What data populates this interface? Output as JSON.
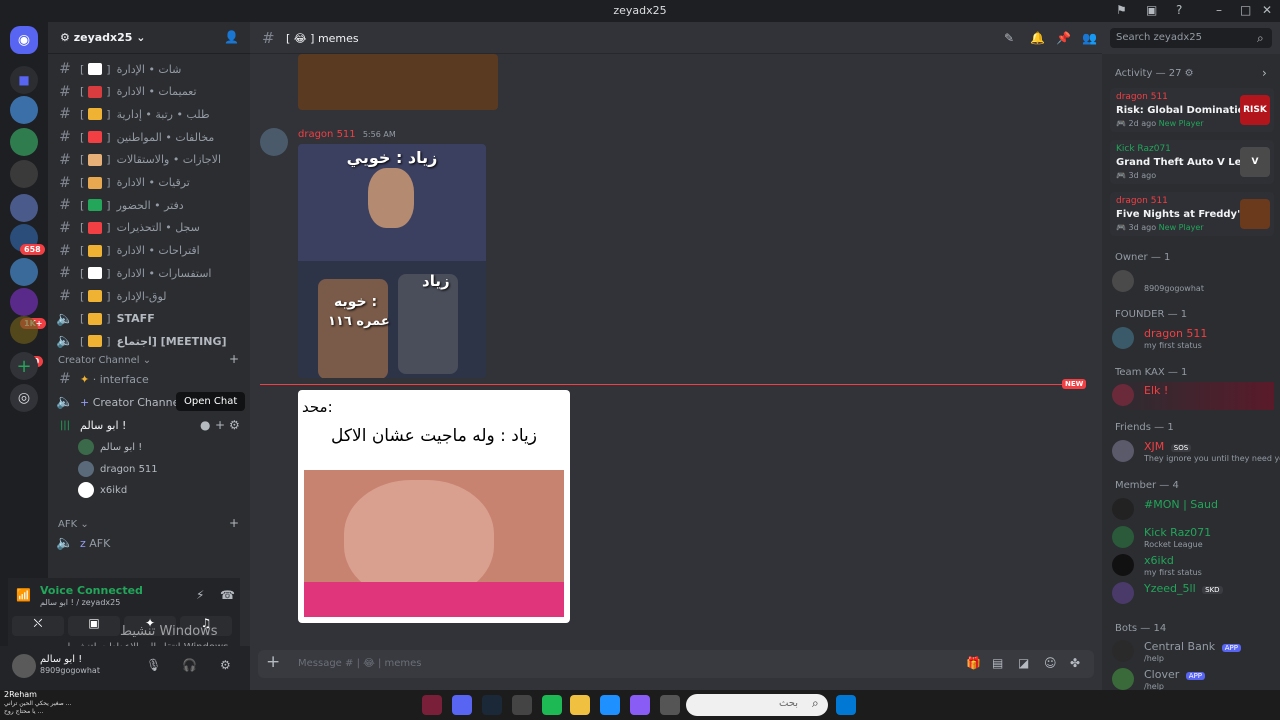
{
  "window": {
    "title": "zeyadx25",
    "controls": [
      "–",
      "□",
      "✕"
    ]
  },
  "server": {
    "name": "zeyadx25",
    "badges": [
      "658",
      "1K+",
      "20"
    ]
  },
  "channels": [
    {
      "name": "شات • الإدارة",
      "icon": "speech-icon",
      "color": "#ffffff"
    },
    {
      "name": "تعميمات • الادارة",
      "icon": "note-icon",
      "color": "#d83c3e"
    },
    {
      "name": "طلب • رتبة • إدارية",
      "icon": "bulb-icon",
      "color": "#f0b232"
    },
    {
      "name": "مخالفات • المواطنين",
      "icon": "no-entry-icon",
      "color": "#f23f43"
    },
    {
      "name": "الاجازات • والاستقالات",
      "icon": "wave-icon",
      "color": "#e8b079"
    },
    {
      "name": "ترقيات • الادارة",
      "icon": "scroll-icon",
      "color": "#e8a84f"
    },
    {
      "name": "دفتر • الحضور",
      "icon": "check-icon",
      "color": "#23a55a"
    },
    {
      "name": "سجل • التحذيرات",
      "icon": "x-icon",
      "color": "#f23f43"
    },
    {
      "name": "اقتراحات • الادارة",
      "icon": "bell-icon",
      "color": "#f0b232"
    },
    {
      "name": "استفسارات • الادارة",
      "icon": "question-icon",
      "color": "#ffffff"
    },
    {
      "name": "لوق-الإدارة",
      "icon": "crown-icon",
      "color": "#f0b232"
    },
    {
      "name": "STAFF",
      "icon": "trident-icon",
      "color": "#f0b232",
      "voice": true
    },
    {
      "name": "اجتماع] [MEETING]",
      "icon": "trident-icon",
      "color": "#f0b232",
      "voice": true
    }
  ],
  "creator_category": "Creator Channel",
  "creator_channels": [
    {
      "name": "· interface"
    },
    {
      "name": "Creator Channel"
    }
  ],
  "tooltip": "Open Chat",
  "voice_channel": {
    "name": "ابو سالم !",
    "users": [
      "ابو سالم !",
      "dragon 511",
      "x6ikd"
    ]
  },
  "afk_category": "AFK",
  "afk_channel": "AFK",
  "voice_panel": {
    "status": "Voice Connected",
    "sub": "ابو سالم ! / zeyadx25"
  },
  "watermark": {
    "line1": "تنشيط Windows",
    "line2": "انتقل إلى الإعدادات لتنشيط Windows"
  },
  "user": {
    "name": "ابو سالم !",
    "tag": "8909gogowhat"
  },
  "chat": {
    "channel": "memes",
    "author": "dragon 511",
    "time": "5:56 AM",
    "meme1_top": "زياد : خويي",
    "meme1_right": "زياد",
    "meme1_left": "خويه :",
    "meme1_left2": "عمره ١١٦",
    "meme2_line1": "محد:",
    "meme2_line2": "زياد : وله ماجيت عشان الاكل",
    "new_label": "NEW",
    "placeholder": "Message # | 😂 | memes"
  },
  "members_panel": {
    "search_placeholder": "Search zeyadx25",
    "activity_title": "Activity — 27",
    "activities": [
      {
        "user": "dragon 511",
        "user_color": "#f23f43",
        "game": "Risk: Global Domination",
        "meta": "2d ago",
        "extra": "New Player",
        "thumb_text": "RISK",
        "thumb_color": "#b3151c"
      },
      {
        "user": "Kick Raz071",
        "user_color": "#23a55a",
        "game": "Grand Theft Auto V Legacy",
        "meta": "3d ago",
        "extra": "",
        "thumb_text": "V",
        "thumb_color": "#4a4a4a"
      },
      {
        "user": "dragon 511",
        "user_color": "#f23f43",
        "game": "Five Nights at Freddy's",
        "meta": "3d ago",
        "extra": "New Player",
        "thumb_text": "",
        "thumb_color": "#6b3a1c"
      }
    ],
    "sections": [
      {
        "title": "Owner — 1",
        "members": [
          {
            "name": "",
            "sub": "8909gogowhat",
            "color": "#dbdee1"
          }
        ]
      },
      {
        "title": "FOUNDER — 1",
        "members": [
          {
            "name": "dragon 511",
            "sub": "my first status",
            "color": "#f23f43"
          }
        ]
      },
      {
        "title": "Team KAX — 1",
        "members": [
          {
            "name": "Elk !",
            "sub": "",
            "color": "#f23f43"
          }
        ]
      },
      {
        "title": "Friends — 1",
        "members": [
          {
            "name": "XJM",
            "sub": "They ignore you until they need you",
            "color": "#f23f43",
            "tag": "SOS"
          }
        ]
      },
      {
        "title": "Member — 4",
        "members": [
          {
            "name": "#MON | Saud",
            "sub": "",
            "color": "#23a55a"
          },
          {
            "name": "Kick Raz071",
            "sub": "Rocket League",
            "color": "#23a55a"
          },
          {
            "name": "x6ikd",
            "sub": "my first status",
            "color": "#23a55a"
          },
          {
            "name": "Yzeed_5ll",
            "sub": "",
            "color": "#23a55a",
            "tag": "SKD"
          }
        ]
      },
      {
        "title": "Bots — 14",
        "members": [
          {
            "name": "Central Bank",
            "sub": "/help",
            "color": "#949ba4",
            "tag": "APP"
          },
          {
            "name": "Clover",
            "sub": "/help",
            "color": "#949ba4",
            "tag": "APP"
          }
        ]
      }
    ]
  },
  "taskbar": {
    "search_placeholder": "بحث",
    "overlay_user": "2Reham",
    "overlay_text": "صغير يحكي الحين تراني ...",
    "overlay_text2": "يا محتاج روح ..."
  }
}
